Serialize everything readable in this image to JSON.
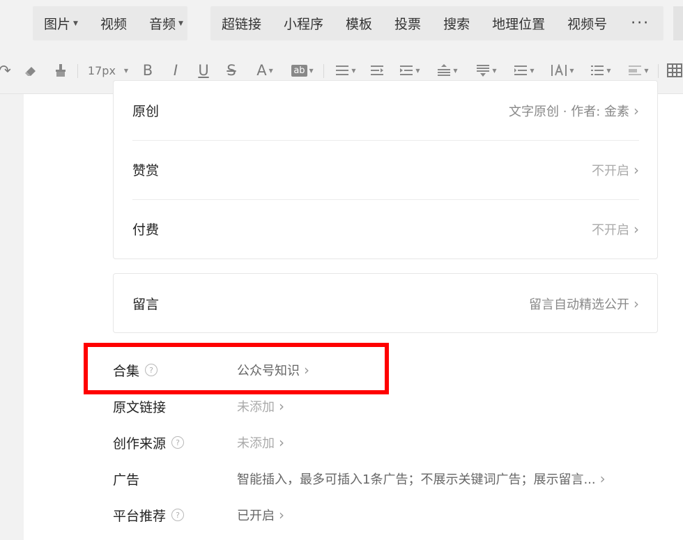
{
  "insert_bar": {
    "group1": [
      {
        "label": "图片",
        "dropdown": true
      },
      {
        "label": "视频",
        "dropdown": false
      },
      {
        "label": "音频",
        "dropdown": true
      }
    ],
    "group2": [
      {
        "label": "超链接"
      },
      {
        "label": "小程序"
      },
      {
        "label": "模板"
      },
      {
        "label": "投票"
      },
      {
        "label": "搜索"
      },
      {
        "label": "地理位置"
      },
      {
        "label": "视频号"
      }
    ],
    "more_label": "···"
  },
  "format_bar": {
    "font_size": "17px",
    "bold": "B",
    "italic": "I",
    "underline": "U",
    "strike": "S",
    "font_color": "A",
    "highlight": "ab"
  },
  "settings": {
    "card1": [
      {
        "label": "原创",
        "value": "文字原创 · 作者: 金素"
      },
      {
        "label": "赞赏",
        "value": "不开启"
      },
      {
        "label": "付费",
        "value": "不开启"
      }
    ],
    "card2": [
      {
        "label": "留言",
        "value": "留言自动精选公开"
      }
    ],
    "rows": [
      {
        "label": "合集",
        "value": "公众号知识"
      },
      {
        "label": "原文链接",
        "value": "未添加"
      },
      {
        "label": "创作来源",
        "value": "未添加"
      },
      {
        "label": "广告",
        "value": "智能插入，最多可插入1条广告；不展示关键词广告；展示留言..."
      },
      {
        "label": "平台推荐",
        "value": "已开启"
      }
    ],
    "chevron": "›",
    "help_glyph": "?"
  },
  "colors": {
    "highlight_box": "#ff0000",
    "page_bg": "#f2f2f2",
    "panel_bg": "#ffffff"
  }
}
